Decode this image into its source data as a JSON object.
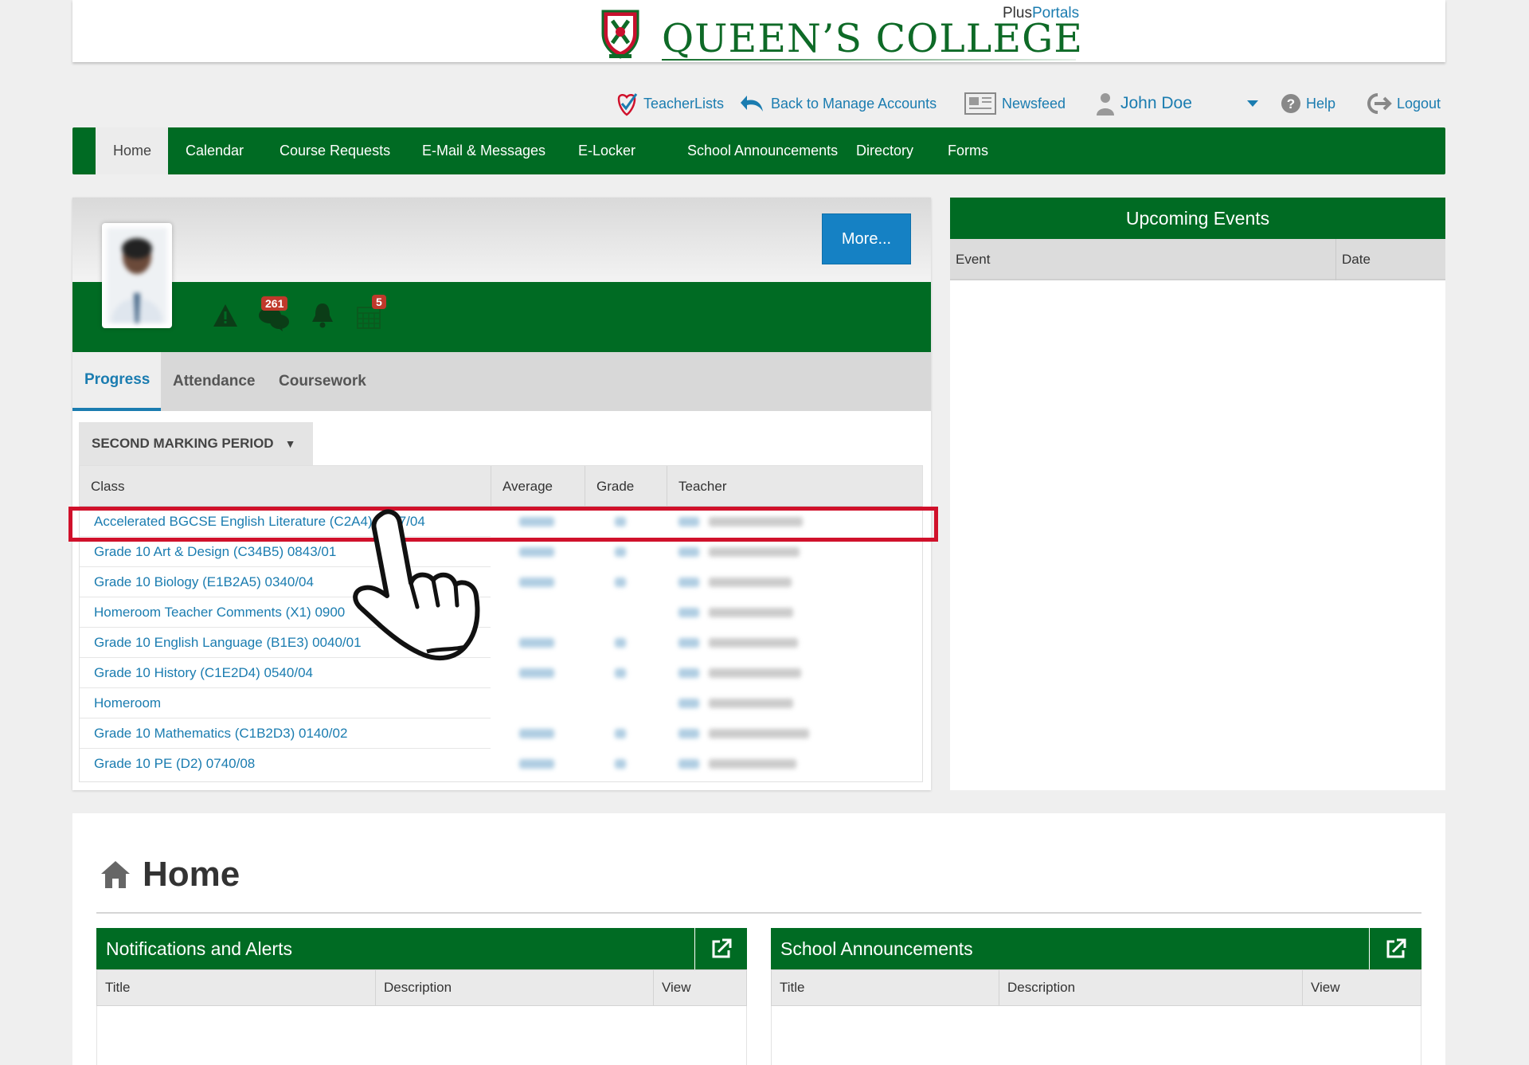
{
  "header": {
    "college_name": "QUEEN’S COLLEGE",
    "brand_plus": "Plus",
    "brand_portals": "Portals"
  },
  "utility": {
    "teacherlists": "TeacherLists",
    "back_to_manage": "Back to Manage Accounts",
    "newsfeed": "Newsfeed",
    "user_name": "John Doe",
    "help": "Help",
    "logout": "Logout"
  },
  "nav": {
    "items": [
      {
        "label": "Home"
      },
      {
        "label": "Calendar"
      },
      {
        "label": "Course Requests"
      },
      {
        "label": "E-Mail & Messages"
      },
      {
        "label": "E-Locker"
      },
      {
        "label": "School Announcements"
      },
      {
        "label": "Directory"
      },
      {
        "label": "Forms"
      }
    ]
  },
  "profile": {
    "more_label": "More...",
    "message_count": "261",
    "calendar_count": "5"
  },
  "tabs": [
    {
      "label": "Progress"
    },
    {
      "label": "Attendance"
    },
    {
      "label": "Coursework"
    }
  ],
  "marking_period": "SECOND MARKING PERIOD",
  "grades": {
    "columns": [
      "Class",
      "Average",
      "Grade",
      "Teacher"
    ],
    "rows": [
      {
        "class": "Accelerated BGCSE English Literature (C2A4) 0347/04"
      },
      {
        "class": "Grade 10 Art & Design (C34B5) 0843/01"
      },
      {
        "class": "Grade 10 Biology (E1B2A5) 0340/04"
      },
      {
        "class": "Homeroom Teacher Comments (X1) 0900"
      },
      {
        "class": "Grade 10 English Language (B1E3) 0040/01"
      },
      {
        "class": "Grade 10 History (C1E2D4) 0540/04"
      },
      {
        "class": "Homeroom"
      },
      {
        "class": "Grade 10 Mathematics (C1B2D3) 0140/02"
      },
      {
        "class": "Grade 10 PE (D2) 0740/08"
      }
    ]
  },
  "events": {
    "title": "Upcoming Events",
    "columns": [
      "Event",
      "Date"
    ]
  },
  "home": {
    "title": "Home",
    "notifications": {
      "title": "Notifications and Alerts",
      "columns": [
        "Title",
        "Description",
        "View"
      ]
    },
    "announcements": {
      "title": "School Announcements",
      "columns": [
        "Title",
        "Description",
        "View"
      ]
    }
  },
  "colors": {
    "brand_green": "#006b23",
    "link_blue": "#1a7cb0",
    "highlight_red": "#d0112b"
  },
  "icons": [
    "crest-logo",
    "teacherlists-icon",
    "back-arrow-icon",
    "newspaper-icon",
    "user-icon",
    "chevron-down-icon",
    "help-icon",
    "logout-icon",
    "warning-icon",
    "messages-icon",
    "bell-icon",
    "calendar-icon",
    "home-icon",
    "external-link-icon",
    "pointer-hand-icon"
  ]
}
